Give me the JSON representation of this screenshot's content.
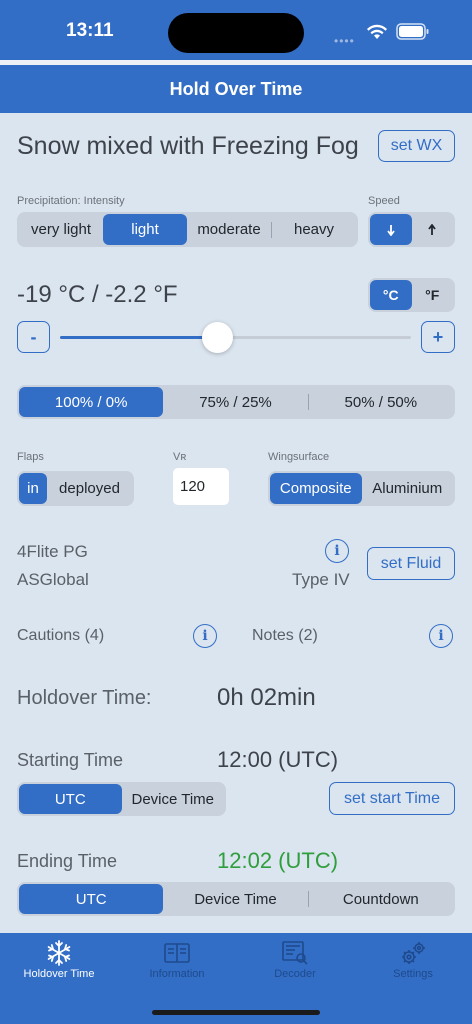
{
  "status": {
    "time": "13:11"
  },
  "header": {
    "title": "Hold Over Time"
  },
  "weather": {
    "condition": "Snow mixed with Freezing Fog",
    "set_wx_label": "set WX"
  },
  "precipitation": {
    "label": "Precipitation: Intensity",
    "options": [
      "very light",
      "light",
      "moderate",
      "heavy"
    ],
    "selected": "light"
  },
  "speed": {
    "label": "Speed",
    "options": [
      "down",
      "up"
    ],
    "selected": "down"
  },
  "temperature": {
    "display": "-19 °C / -2.2 °F",
    "units": [
      "°C",
      "°F"
    ],
    "selected_unit": "°C",
    "minus_label": "-",
    "plus_label": "+",
    "slider_fraction": 0.45
  },
  "mix": {
    "options": [
      "100% / 0%",
      "75% / 25%",
      "50% / 50%"
    ],
    "selected": "100% / 0%"
  },
  "flaps": {
    "label": "Flaps",
    "options": [
      "in",
      "deployed"
    ],
    "selected": "in"
  },
  "vr": {
    "label": "Vʀ",
    "value": "120"
  },
  "wingsurface": {
    "label": "Wingsurface",
    "options": [
      "Composite",
      "Aluminium"
    ],
    "selected": "Composite"
  },
  "fluid": {
    "name": "4Flite PG",
    "manufacturer": "ASGlobal",
    "type": "Type IV",
    "set_fluid_label": "set Fluid"
  },
  "cautions": {
    "label": "Cautions (4)"
  },
  "notes": {
    "label": "Notes (2)"
  },
  "holdover": {
    "label": "Holdover Time:",
    "value": "0h 02min"
  },
  "starting": {
    "label": "Starting Time",
    "value": "12:00 (UTC)",
    "options": [
      "UTC",
      "Device Time"
    ],
    "selected": "UTC",
    "set_start_label": "set start Time"
  },
  "ending": {
    "label": "Ending Time",
    "value": "12:02 (UTC)",
    "options": [
      "UTC",
      "Device Time",
      "Countdown"
    ],
    "selected": "UTC"
  },
  "tabs": [
    {
      "label": "Holdover Time",
      "icon": "snowflake-icon"
    },
    {
      "label": "Information",
      "icon": "book-icon"
    },
    {
      "label": "Decoder",
      "icon": "document-search-icon"
    },
    {
      "label": "Settings",
      "icon": "gears-icon"
    }
  ],
  "colors": {
    "accent": "#336ec6",
    "background": "#dbe5ef",
    "ending_time": "#2f9e3c"
  }
}
